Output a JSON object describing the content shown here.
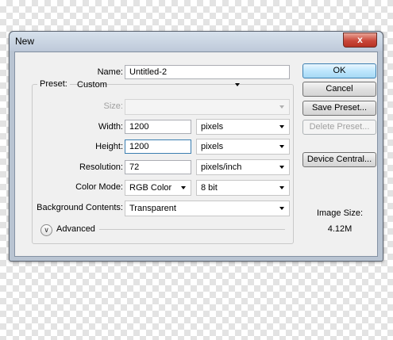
{
  "window": {
    "title": "New",
    "close_glyph": "x"
  },
  "form": {
    "name_label": "Name:",
    "name_value": "Untitled-2",
    "preset_label": "Preset:",
    "preset_value": "Custom",
    "size_label": "Size:",
    "size_value": "",
    "width_label": "Width:",
    "width_value": "1200",
    "width_unit": "pixels",
    "height_label": "Height:",
    "height_value": "1200",
    "height_unit": "pixels",
    "resolution_label": "Resolution:",
    "resolution_value": "72",
    "resolution_unit": "pixels/inch",
    "color_mode_label": "Color Mode:",
    "color_mode_value": "RGB Color",
    "bit_depth_value": "8 bit",
    "background_label": "Background Contents:",
    "background_value": "Transparent",
    "advanced_label": "Advanced"
  },
  "buttons": {
    "ok": "OK",
    "cancel": "Cancel",
    "save_preset": "Save Preset...",
    "delete_preset": "Delete Preset...",
    "device_central": "Device Central..."
  },
  "image_size": {
    "label": "Image Size:",
    "value": "4.12M"
  },
  "icons": {
    "close": "close-icon",
    "advanced": "chevron-down-double-icon",
    "dropdown": "chevron-down-icon"
  },
  "colors": {
    "accent": "#3c7fb1",
    "close_red": "#c9473a",
    "frame": "#b9c4d2"
  }
}
